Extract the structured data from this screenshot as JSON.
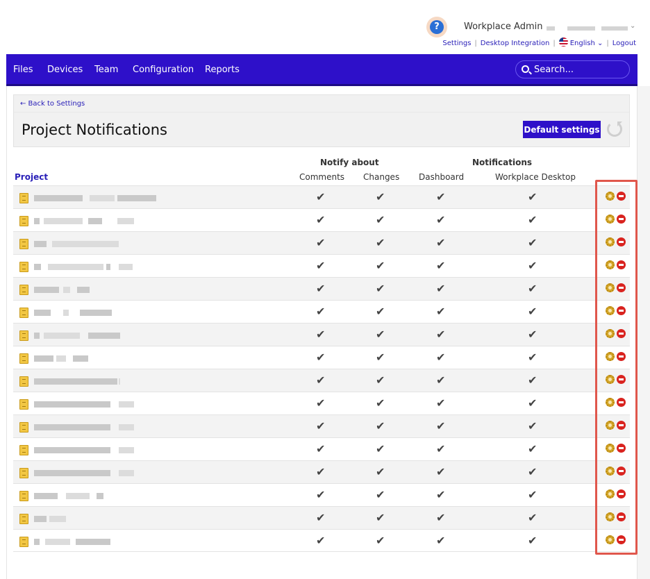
{
  "header": {
    "help_icon": "?",
    "user_name": "Workplace Admin",
    "links": {
      "settings": "Settings",
      "desktop_integration": "Desktop Integration",
      "language": "English",
      "logout": "Logout"
    }
  },
  "nav": {
    "files": "Files",
    "devices": "Devices",
    "team": "Team",
    "configuration": "Configuration",
    "reports": "Reports",
    "search_placeholder": "Search..."
  },
  "panel": {
    "back_link": "← Back to Settings",
    "title": "Project Notifications",
    "default_button": "Default settings"
  },
  "table": {
    "group_notify": "Notify about",
    "group_notifications": "Notifications",
    "project_header": "Project",
    "columns": [
      "Comments",
      "Changes",
      "Dashboard",
      "Workplace Desktop"
    ],
    "check_glyph": "✔",
    "row_count": 16
  },
  "colors": {
    "brand": "#2e10c9",
    "highlight": "#e0574c",
    "link": "#2a20b8"
  }
}
